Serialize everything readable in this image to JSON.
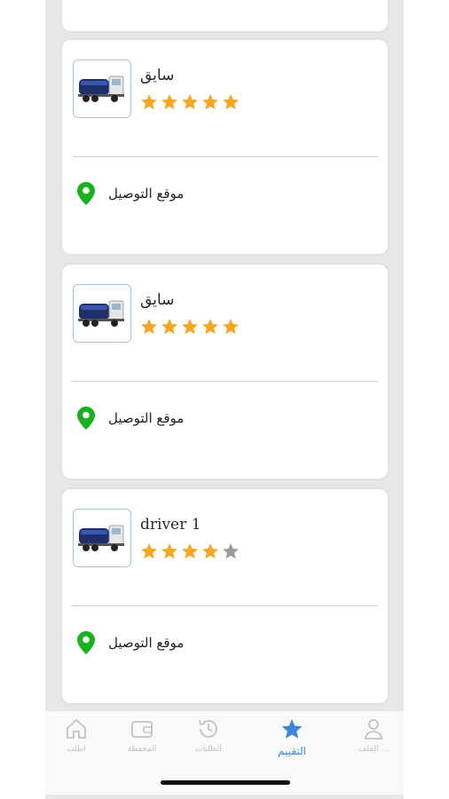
{
  "colors": {
    "star_filled": "#f5a623",
    "star_empty": "#9b9b9b",
    "pin": "#19b21f",
    "tab_active": "#3e86d8",
    "tab_inactive": "#c2c2c2"
  },
  "cards": [
    {
      "driver_name": "سايق",
      "rating": 5,
      "max_rating": 5,
      "location_label": "موقع التوصيل",
      "image_icon": "tanker-truck-icon"
    },
    {
      "driver_name": "سايق",
      "rating": 5,
      "max_rating": 5,
      "location_label": "موقع التوصيل",
      "image_icon": "tanker-truck-icon"
    },
    {
      "driver_name": "driver 1",
      "rating": 4,
      "max_rating": 5,
      "location_label": "موقع التوصيل",
      "image_icon": "tanker-truck-icon"
    }
  ],
  "tabbar": {
    "tabs": [
      {
        "label": "الملف ...",
        "icon": "profile-icon",
        "active": false
      },
      {
        "label": "التقييم",
        "icon": "star-icon",
        "active": true
      },
      {
        "label": "الطلبات",
        "icon": "history-icon",
        "active": false
      },
      {
        "label": "المحفظة",
        "icon": "wallet-icon",
        "active": false
      },
      {
        "label": "اطلب",
        "icon": "home-icon",
        "active": false
      }
    ]
  }
}
